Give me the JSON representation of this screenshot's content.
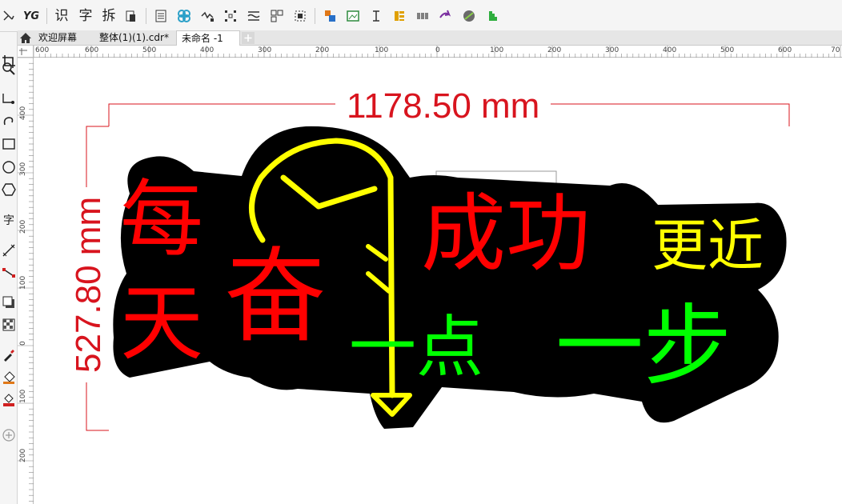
{
  "toolbar": {
    "text_tools": [
      "识",
      "字",
      "拆"
    ],
    "brand": "YG"
  },
  "tabs": [
    {
      "label": "欢迎屏幕"
    },
    {
      "label": "整体(1)(1).cdr*"
    },
    {
      "label": "未命名 -1"
    }
  ],
  "toolbox": {
    "text_tool_label": "字"
  },
  "ruler_top": {
    "labels": [
      "600",
      "500",
      "400",
      "300",
      "200",
      "100",
      "0",
      "100",
      "200",
      "300",
      "400",
      "500",
      "600",
      "70"
    ]
  },
  "ruler_left": {
    "labels": [
      "400",
      "300",
      "200",
      "100",
      "0",
      "100",
      "200"
    ]
  },
  "canvas": {
    "dimension_width": "1178.50 mm",
    "dimension_height": "527.80 mm",
    "sign_lines": [
      {
        "text": "每",
        "color": "#ff0000"
      },
      {
        "text": "天",
        "color": "#ff0000"
      },
      {
        "text": "奋",
        "color": "#ff0000"
      },
      {
        "text": "成功",
        "color": "#ff0000"
      },
      {
        "text": "更近",
        "color": "#ffff00"
      },
      {
        "text": "一点",
        "color": "#00ff00"
      },
      {
        "text": "一步",
        "color": "#00ff00"
      }
    ],
    "colors": {
      "dimension": "#d8141e",
      "outline": "#000000",
      "red": "#ff0000",
      "yellow": "#ffff00",
      "green": "#00ff00"
    }
  }
}
